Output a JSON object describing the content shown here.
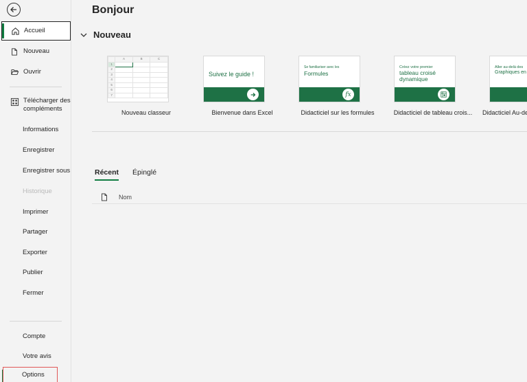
{
  "sidebar": {
    "back_label": "Retour",
    "items": [
      {
        "label": "Accueil"
      },
      {
        "label": "Nouveau"
      },
      {
        "label": "Ouvrir"
      },
      {
        "label": "Télécharger des compléments"
      },
      {
        "label": "Informations"
      },
      {
        "label": "Enregistrer"
      },
      {
        "label": "Enregistrer sous"
      },
      {
        "label": "Historique"
      },
      {
        "label": "Imprimer"
      },
      {
        "label": "Partager"
      },
      {
        "label": "Exporter"
      },
      {
        "label": "Publier"
      },
      {
        "label": "Fermer"
      }
    ],
    "bottom_items": [
      {
        "label": "Compte"
      },
      {
        "label": "Votre avis"
      },
      {
        "label": "Options"
      }
    ]
  },
  "main": {
    "greeting": "Bonjour",
    "new_section_title": "Nouveau",
    "templates": [
      {
        "caption": "Nouveau classeur"
      },
      {
        "caption": "Bienvenue dans Excel",
        "thumb_text": "Suivez le guide !"
      },
      {
        "caption": "Didacticiel sur les formules",
        "thumb_small": "Se familiariser avec les",
        "thumb_big": "Formules"
      },
      {
        "caption": "Didacticiel de tableau crois...",
        "thumb_small": "Créez votre premier",
        "thumb_big": "tableau croisé dynamique"
      },
      {
        "caption": "Didacticiel Au-de",
        "thumb_small": "Aller au-delà des",
        "thumb_big": "Graphiques en"
      }
    ],
    "grid_columns": [
      "A",
      "B",
      "C"
    ],
    "grid_rows": [
      "1",
      "2",
      "3",
      "4",
      "5",
      "6",
      "7"
    ],
    "badge_fx": "fx",
    "tabs": [
      {
        "label": "Récent"
      },
      {
        "label": "Épinglé"
      }
    ],
    "list_header": {
      "name_col": "Nom"
    }
  },
  "colors": {
    "accent": "#107c41",
    "band": "#1e7145",
    "highlight": "#e05656"
  }
}
